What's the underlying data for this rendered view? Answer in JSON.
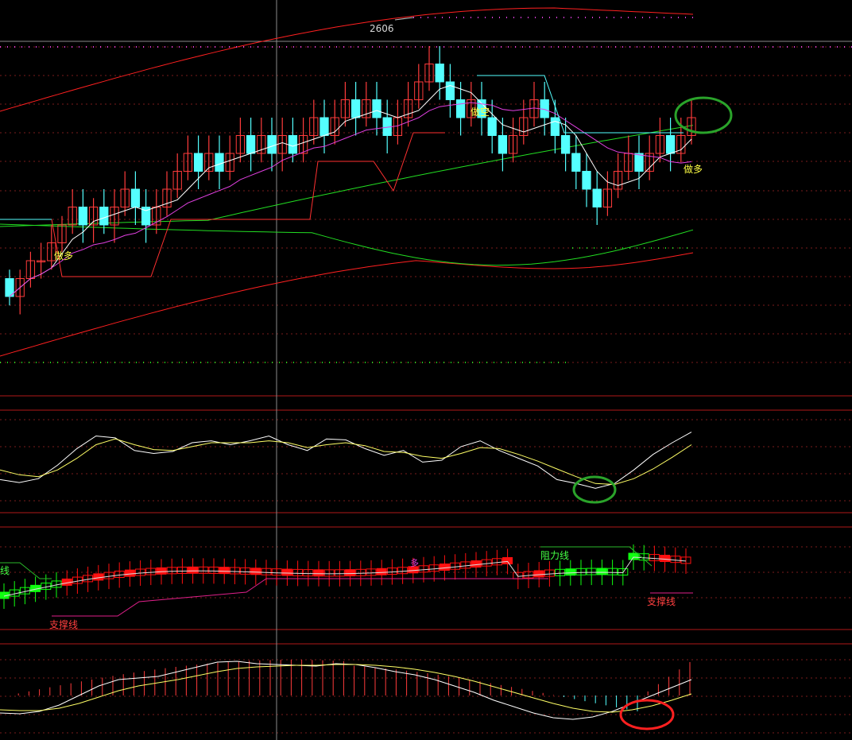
{
  "colors": {
    "background": "#000000",
    "up_candle": "#ff3b3b",
    "down_candle": "#54ffff",
    "grid": "#7a1d1d",
    "divider": "#b01818",
    "crosshair": "#8a8a8a",
    "boll_outer": "#ff2020",
    "boll_mid": "#22dd22",
    "ma_short": "#ffffff",
    "ma_mid": "#e040e0",
    "stop_line": "#ff3030",
    "kdj_k": "#ffffff",
    "kdj_d": "#ffff66",
    "resist": "#2ab82a",
    "support": "#e0208a",
    "bar_red": "#ff1010",
    "bar_green": "#10ff10",
    "marker_green": "#2aa32a",
    "marker_red": "#ff2020",
    "label_yellow": "#ffff44",
    "label_red": "#ff4040",
    "label_green": "#44ff44"
  },
  "annotations": {
    "high_price": "2606",
    "short_signal": "做空",
    "long_signal_left": "做多",
    "long_signal_right": "做多",
    "resistance_label": "阻力线",
    "support_label": "支撑线",
    "resistance_label_left": "线",
    "multi_label": "多"
  },
  "chart_data": [
    {
      "type": "candlestick",
      "panel": "price",
      "title": "",
      "annotations": [
        "2606",
        "做空",
        "做多",
        "做多"
      ],
      "candles": [
        [
          5,
          4,
          5.5,
          3.5
        ],
        [
          4,
          5,
          5.5,
          3
        ],
        [
          5,
          6,
          6.5,
          4.5
        ],
        [
          6,
          6,
          7,
          5
        ],
        [
          6,
          7,
          8,
          5.5
        ],
        [
          7,
          8,
          8.5,
          6.5
        ],
        [
          8,
          9,
          10,
          7.5
        ],
        [
          9,
          8,
          10,
          7
        ],
        [
          8,
          9,
          9.5,
          7
        ],
        [
          9,
          8,
          10,
          7.5
        ],
        [
          8,
          9,
          10,
          7
        ],
        [
          9,
          10,
          11,
          8.5
        ],
        [
          10,
          9,
          11,
          8
        ],
        [
          9,
          8,
          10,
          7
        ],
        [
          8,
          9,
          10,
          7.5
        ],
        [
          9,
          10,
          11,
          8.5
        ],
        [
          10,
          11,
          12,
          9.5
        ],
        [
          11,
          12,
          13,
          10.5
        ],
        [
          12,
          11,
          13,
          10
        ],
        [
          11,
          12,
          13,
          10.5
        ],
        [
          12,
          11,
          13,
          10
        ],
        [
          11,
          12,
          13,
          10.5
        ],
        [
          12,
          13,
          14,
          11.5
        ],
        [
          13,
          12,
          14,
          11
        ],
        [
          12,
          13,
          14,
          11.5
        ],
        [
          13,
          12,
          14,
          11
        ],
        [
          12,
          13,
          14,
          11
        ],
        [
          13,
          12,
          14,
          11.5
        ],
        [
          12,
          13,
          14,
          11.5
        ],
        [
          13,
          14,
          15,
          12.5
        ],
        [
          14,
          13,
          15,
          12
        ],
        [
          13,
          14,
          15,
          12.5
        ],
        [
          14,
          15,
          16,
          13.5
        ],
        [
          15,
          14,
          16,
          13
        ],
        [
          14,
          15,
          16,
          13.5
        ],
        [
          15,
          14,
          16,
          13
        ],
        [
          14,
          13,
          15,
          12
        ],
        [
          13,
          14,
          15,
          12.5
        ],
        [
          14,
          15,
          16,
          13.5
        ],
        [
          15,
          16,
          17,
          14.5
        ],
        [
          16,
          17,
          18,
          15.5
        ],
        [
          17,
          16,
          18,
          15
        ],
        [
          16,
          15,
          17,
          14
        ],
        [
          15,
          14,
          16,
          13
        ],
        [
          14,
          15,
          16,
          13.5
        ],
        [
          15,
          14,
          16,
          13
        ],
        [
          14,
          13,
          15,
          12
        ],
        [
          13,
          12,
          14,
          11
        ],
        [
          12,
          13,
          14,
          11.5
        ],
        [
          13,
          14,
          15,
          12.5
        ],
        [
          14,
          15,
          16,
          13.5
        ],
        [
          15,
          14,
          16,
          13
        ],
        [
          14,
          13,
          15,
          12
        ],
        [
          13,
          12,
          14,
          11
        ],
        [
          12,
          11,
          13,
          10
        ],
        [
          11,
          10,
          12,
          9
        ],
        [
          10,
          9,
          11,
          8
        ],
        [
          9,
          10,
          11,
          8.5
        ],
        [
          10,
          11,
          12,
          9.5
        ],
        [
          11,
          12,
          13,
          10.5
        ],
        [
          12,
          11,
          13,
          10
        ],
        [
          11,
          12,
          13,
          10.5
        ],
        [
          12,
          13,
          14,
          11.5
        ],
        [
          13,
          12,
          14,
          11
        ],
        [
          12,
          13,
          14,
          11.5
        ],
        [
          13,
          14,
          15,
          12.5
        ]
      ]
    },
    {
      "type": "line",
      "panel": "oscillator",
      "series": [
        {
          "values": [
            30,
            27,
            31,
            45,
            62,
            75,
            73,
            60,
            57,
            59,
            68,
            70,
            66,
            70,
            75,
            66,
            60,
            72,
            71,
            62,
            55,
            60,
            48,
            50,
            64,
            70,
            60,
            52,
            44,
            30,
            26,
            21,
            26,
            40,
            56,
            68,
            79
          ]
        },
        {
          "values": [
            40,
            35,
            33,
            40,
            52,
            66,
            72,
            66,
            61,
            60,
            64,
            68,
            68,
            68,
            70,
            68,
            63,
            66,
            68,
            65,
            59,
            58,
            54,
            52,
            57,
            63,
            62,
            56,
            49,
            41,
            33,
            26,
            25,
            31,
            41,
            53,
            66
          ]
        }
      ]
    },
    {
      "type": "bar",
      "panel": "trend",
      "annotations": [
        "阻力线",
        "支撑线",
        "多",
        "线"
      ]
    },
    {
      "type": "line",
      "panel": "macd",
      "series": [
        {
          "values": [
            18,
            17,
            20,
            28,
            40,
            52,
            60,
            62,
            64,
            70,
            76,
            82,
            83,
            80,
            79,
            78,
            77,
            80,
            79,
            75,
            70,
            66,
            60,
            52,
            44,
            34,
            26,
            18,
            12,
            10,
            13,
            20,
            30,
            40,
            50,
            60
          ]
        },
        {
          "values": [
            22,
            21,
            21,
            24,
            30,
            38,
            46,
            52,
            56,
            60,
            65,
            70,
            74,
            76,
            77,
            78,
            78,
            79,
            79,
            78,
            76,
            73,
            69,
            64,
            58,
            51,
            44,
            37,
            30,
            24,
            20,
            19,
            22,
            27,
            34,
            42
          ]
        }
      ]
    }
  ]
}
